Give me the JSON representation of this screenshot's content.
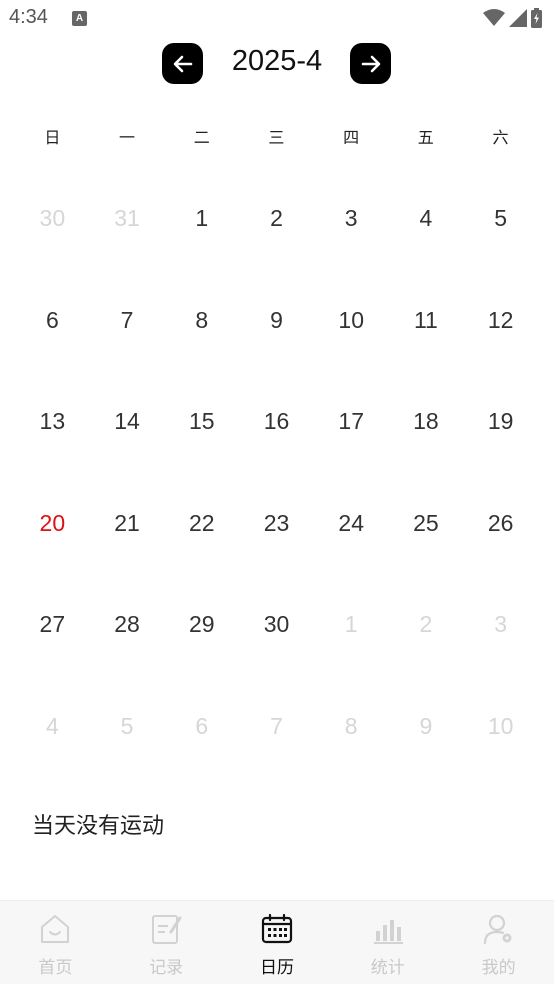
{
  "status_bar": {
    "time": "4:34",
    "notif_glyph": "A"
  },
  "header": {
    "title": "2025-4",
    "prev_icon": "arrow-left-icon",
    "next_icon": "arrow-right-icon"
  },
  "weekdays": [
    "日",
    "一",
    "二",
    "三",
    "四",
    "五",
    "六"
  ],
  "days": [
    {
      "n": "30",
      "cur": false
    },
    {
      "n": "31",
      "cur": false
    },
    {
      "n": "1",
      "cur": true
    },
    {
      "n": "2",
      "cur": true
    },
    {
      "n": "3",
      "cur": true
    },
    {
      "n": "4",
      "cur": true
    },
    {
      "n": "5",
      "cur": true
    },
    {
      "n": "6",
      "cur": true
    },
    {
      "n": "7",
      "cur": true
    },
    {
      "n": "8",
      "cur": true
    },
    {
      "n": "9",
      "cur": true
    },
    {
      "n": "10",
      "cur": true
    },
    {
      "n": "11",
      "cur": true
    },
    {
      "n": "12",
      "cur": true
    },
    {
      "n": "13",
      "cur": true
    },
    {
      "n": "14",
      "cur": true
    },
    {
      "n": "15",
      "cur": true
    },
    {
      "n": "16",
      "cur": true
    },
    {
      "n": "17",
      "cur": true
    },
    {
      "n": "18",
      "cur": true
    },
    {
      "n": "19",
      "cur": true
    },
    {
      "n": "20",
      "cur": true,
      "today": true
    },
    {
      "n": "21",
      "cur": true
    },
    {
      "n": "22",
      "cur": true
    },
    {
      "n": "23",
      "cur": true
    },
    {
      "n": "24",
      "cur": true
    },
    {
      "n": "25",
      "cur": true
    },
    {
      "n": "26",
      "cur": true
    },
    {
      "n": "27",
      "cur": true
    },
    {
      "n": "28",
      "cur": true
    },
    {
      "n": "29",
      "cur": true
    },
    {
      "n": "30",
      "cur": true
    },
    {
      "n": "1",
      "cur": false
    },
    {
      "n": "2",
      "cur": false
    },
    {
      "n": "3",
      "cur": false
    },
    {
      "n": "4",
      "cur": false
    },
    {
      "n": "5",
      "cur": false
    },
    {
      "n": "6",
      "cur": false
    },
    {
      "n": "7",
      "cur": false
    },
    {
      "n": "8",
      "cur": false
    },
    {
      "n": "9",
      "cur": false
    },
    {
      "n": "10",
      "cur": false
    }
  ],
  "message": "当天没有运动",
  "tabs": [
    {
      "label": "首页",
      "icon": "home-icon",
      "active": false
    },
    {
      "label": "记录",
      "icon": "edit-record-icon",
      "active": false
    },
    {
      "label": "日历",
      "icon": "calendar-icon",
      "active": true
    },
    {
      "label": "统计",
      "icon": "bar-chart-icon",
      "active": false
    },
    {
      "label": "我的",
      "icon": "user-settings-icon",
      "active": false
    }
  ],
  "colors": {
    "today": "#e01010",
    "inactive_tab": "#c9c9c9",
    "active_tab": "#111111"
  }
}
